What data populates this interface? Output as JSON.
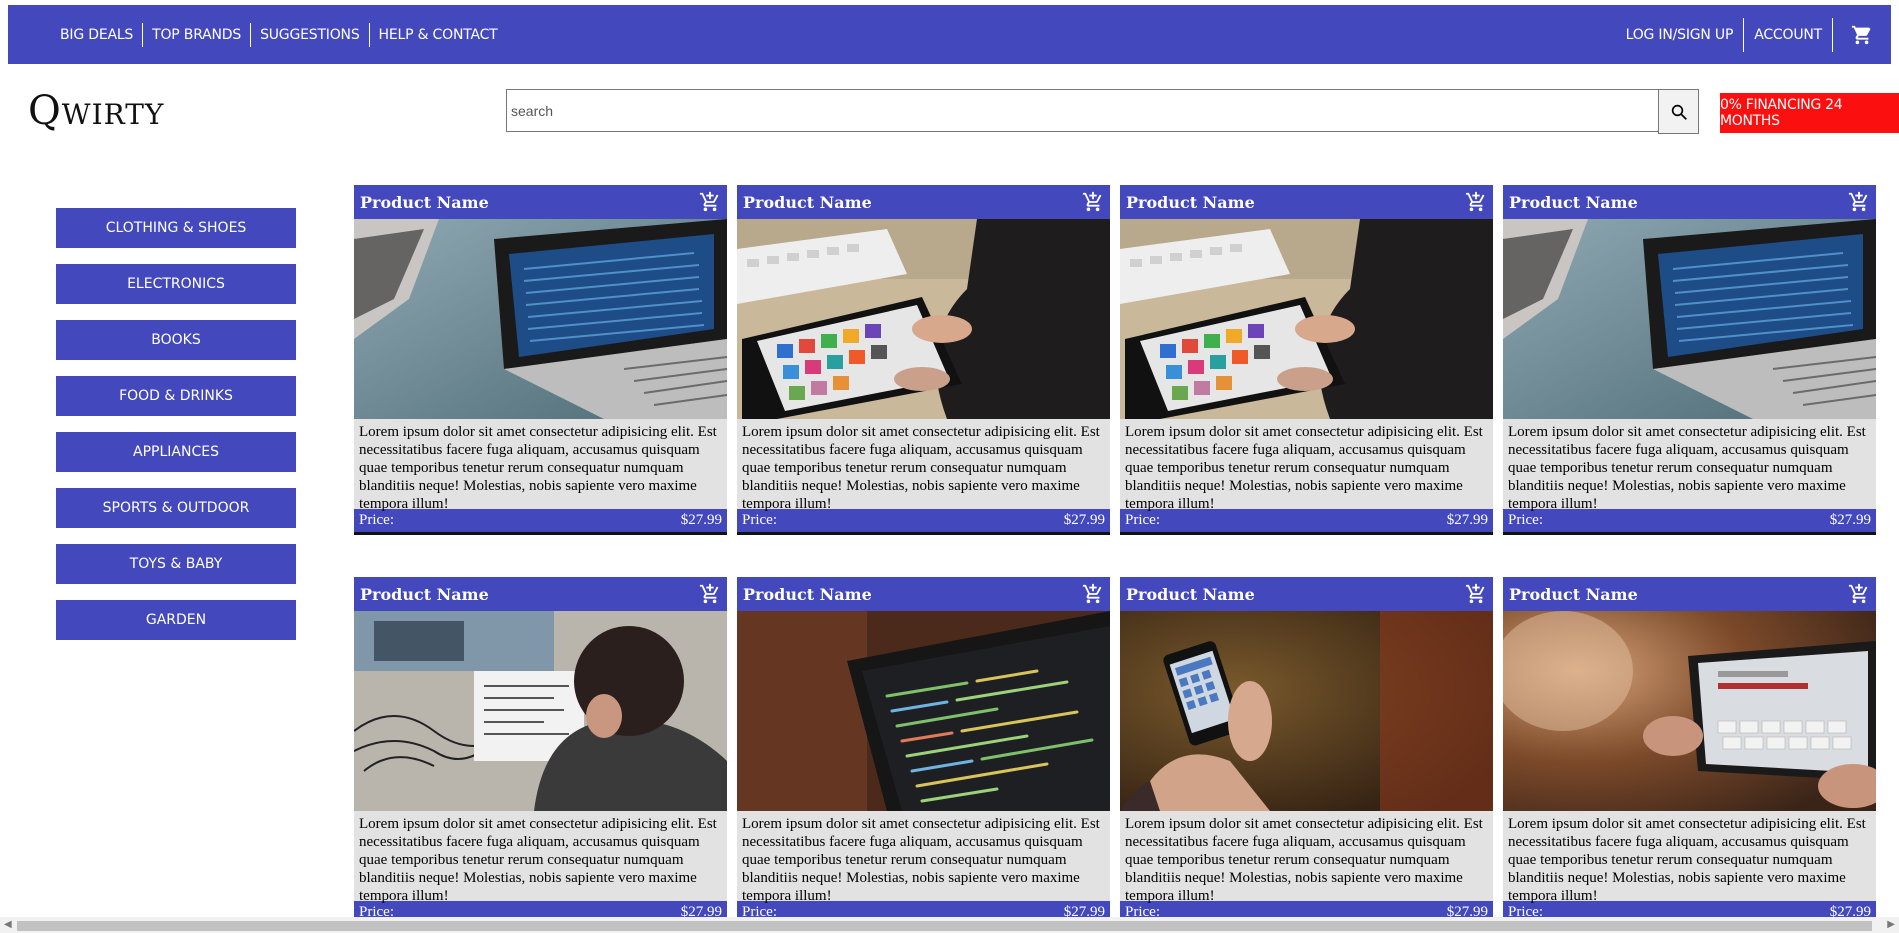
{
  "nav": {
    "left": [
      "BIG DEALS",
      "TOP BRANDS",
      "SUGGESTIONS",
      "HELP & CONTACT"
    ],
    "login": "LOG IN/SIGN UP",
    "account": "ACCOUNT",
    "cart_icon": "cart-icon"
  },
  "brand": {
    "logo": "Qwirty"
  },
  "search": {
    "placeholder": "search",
    "value": "",
    "icon": "search-icon"
  },
  "promo": {
    "financing": "0% FINANCING 24 MONTHS"
  },
  "categories": [
    "CLOTHING & SHOES",
    "ELECTRONICS",
    "BOOKS",
    "FOOD & DRINKS",
    "APPLIANCES",
    "SPORTS & OUTDOOR",
    "TOYS & BABY",
    "GARDEN"
  ],
  "products": [
    {
      "name": "Product Name",
      "desc": "Lorem ipsum dolor sit amet consectetur adipisicing elit. Est necessitatibus facere fuga aliquam, accusamus quisquam quae temporibus tenetur rerum consequatur numquam blanditiis neque! Molestias, nobis sapiente vero maxime tempora illum!",
      "price_label": "Price:",
      "price": "$27.99",
      "image": "laptop-photo"
    },
    {
      "name": "Product Name",
      "desc": "Lorem ipsum dolor sit amet consectetur adipisicing elit. Est necessitatibus facere fuga aliquam, accusamus quisquam quae temporibus tenetur rerum consequatur numquam blanditiis neque! Molestias, nobis sapiente vero maxime tempora illum!",
      "price_label": "Price:",
      "price": "$27.99",
      "image": "tablet-photo"
    },
    {
      "name": "Product Name",
      "desc": "Lorem ipsum dolor sit amet consectetur adipisicing elit. Est necessitatibus facere fuga aliquam, accusamus quisquam quae temporibus tenetur rerum consequatur numquam blanditiis neque! Molestias, nobis sapiente vero maxime tempora illum!",
      "price_label": "Price:",
      "price": "$27.99",
      "image": "tablet-photo"
    },
    {
      "name": "Product Name",
      "desc": "Lorem ipsum dolor sit amet consectetur adipisicing elit. Est necessitatibus facere fuga aliquam, accusamus quisquam quae temporibus tenetur rerum consequatur numquam blanditiis neque! Molestias, nobis sapiente vero maxime tempora illum!",
      "price_label": "Price:",
      "price": "$27.99",
      "image": "laptop-photo"
    },
    {
      "name": "Product Name",
      "desc": "Lorem ipsum dolor sit amet consectetur adipisicing elit. Est necessitatibus facere fuga aliquam, accusamus quisquam quae temporibus tenetur rerum consequatur numquam blanditiis neque! Molestias, nobis sapiente vero maxime tempora illum!",
      "price_label": "Price:",
      "price": "$27.99",
      "image": "developer-photo"
    },
    {
      "name": "Product Name",
      "desc": "Lorem ipsum dolor sit amet consectetur adipisicing elit. Est necessitatibus facere fuga aliquam, accusamus quisquam quae temporibus tenetur rerum consequatur numquam blanditiis neque! Molestias, nobis sapiente vero maxime tempora illum!",
      "price_label": "Price:",
      "price": "$27.99",
      "image": "code-screen-photo"
    },
    {
      "name": "Product Name",
      "desc": "Lorem ipsum dolor sit amet consectetur adipisicing elit. Est necessitatibus facere fuga aliquam, accusamus quisquam quae temporibus tenetur rerum consequatur numquam blanditiis neque! Molestias, nobis sapiente vero maxime tempora illum!",
      "price_label": "Price:",
      "price": "$27.99",
      "image": "smartphone-photo"
    },
    {
      "name": "Product Name",
      "desc": "Lorem ipsum dolor sit amet consectetur adipisicing elit. Est necessitatibus facere fuga aliquam, accusamus quisquam quae temporibus tenetur rerum consequatur numquam blanditiis neque! Molestias, nobis sapiente vero maxime tempora illum!",
      "price_label": "Price:",
      "price": "$27.99",
      "image": "tablet-hands-photo"
    }
  ],
  "colors": {
    "primary": "#4349bd",
    "promo": "#fb0f0f",
    "card_bg": "#e2e2e2"
  }
}
